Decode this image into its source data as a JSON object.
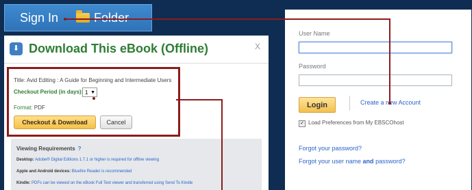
{
  "topbar": {
    "signin_label": "Sign In",
    "folder_label": "Folder",
    "folder_icon": "folder-icon"
  },
  "dialog": {
    "title": "Download This eBook (Offline)",
    "close": "X",
    "book_title": "Title: Avid Editing : A Guide for Beginning and Intermediate Users",
    "checkout_period_label": "Checkout Period (in days):",
    "checkout_period_value": "1",
    "format_label": "Format:",
    "format_value": "PDF",
    "checkout_button": "Checkout & Download",
    "cancel_button": "Cancel",
    "requirements": {
      "title": "Viewing Requirements",
      "info": "?",
      "desktop_label": "Desktop:",
      "desktop_text": "Adobe® Digital Editions 1.7.1 or higher is required for offline viewing",
      "apps_label": "Apple and Android devices:",
      "apps_text": "Bluefire Reader is recommended",
      "kindle_label": "Kindle:",
      "kindle_text": "PDFs can be viewed on the eBook Full Text viewer and transferred using Send To Kindle"
    }
  },
  "login": {
    "username_label": "User Name",
    "password_label": "Password",
    "login_button": "Login",
    "create_account": "Create a new Account",
    "load_prefs": "Load Preferences from My EBSCOhost",
    "forgot_password": "Forgot your password?",
    "forgot_both_prefix": "Forgot your user name ",
    "forgot_both_and": "and",
    "forgot_both_suffix": " password?"
  },
  "colors": {
    "background": "#0f2d52",
    "callout": "#8c1b1b",
    "accent_green": "#2e7d34",
    "link": "#2a64c8"
  }
}
